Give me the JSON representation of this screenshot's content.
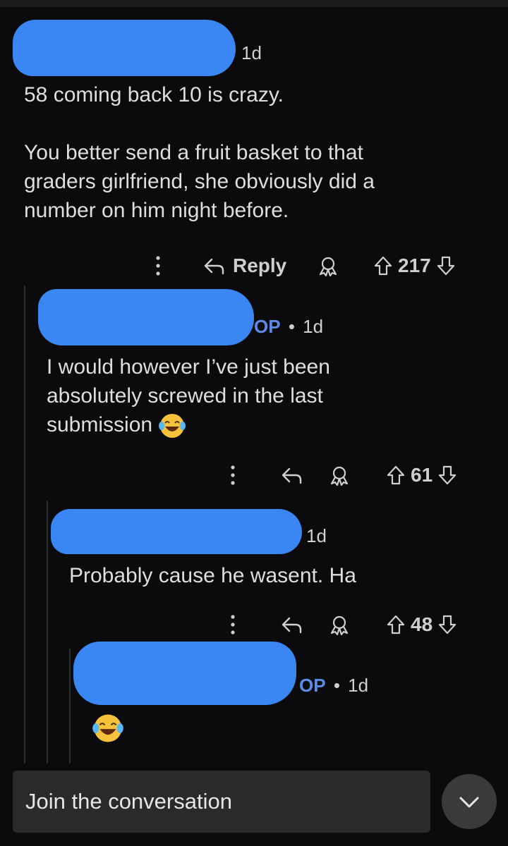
{
  "comments": [
    {
      "time": "1d",
      "body": [
        "58 coming back 10 is crazy.",
        "",
        "You better send a fruit basket to that",
        "graders girlfriend, she obviously did a",
        "number on him night before."
      ],
      "reply_label": "Reply",
      "votes": "217"
    },
    {
      "op_label": "OP",
      "sep": "•",
      "time": "1d",
      "body": [
        "I would however I’ve just been",
        "absolutely screwed in the last",
        "submission"
      ],
      "votes": "61"
    },
    {
      "time": "1d",
      "body": [
        "Probably cause he wasent. Ha"
      ],
      "votes": "48"
    },
    {
      "op_label": "OP",
      "sep": "•",
      "time": "1d"
    }
  ],
  "footer": {
    "placeholder": "Join the conversation"
  },
  "colors": {
    "redaction": "#3a86f3",
    "op": "#5b8ce6",
    "background": "#0b0b0d"
  }
}
